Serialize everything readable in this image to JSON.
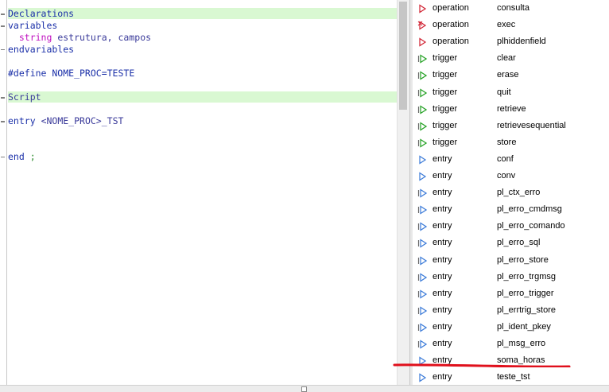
{
  "editor": {
    "lines": {
      "declarations": "Declarations",
      "variables": "variables",
      "string_kw": "string",
      "string_vars": "estrutura, campos",
      "endvariables": "endvariables",
      "define": "#define NOME_PROC=TESTE",
      "script": "Script",
      "entry_kw": "entry",
      "entry_name": "<NOME_PROC>_TST",
      "end_kw": "end",
      "end_semi": ";"
    }
  },
  "outline": {
    "items": [
      {
        "kind": "operation",
        "name": "consulta",
        "icon": "operation-icon"
      },
      {
        "kind": "operation",
        "name": "exec",
        "icon": "operation-private-icon"
      },
      {
        "kind": "operation",
        "name": "plhiddenfield",
        "icon": "operation-icon"
      },
      {
        "kind": "trigger",
        "name": "clear",
        "icon": "trigger-icon"
      },
      {
        "kind": "trigger",
        "name": "erase",
        "icon": "trigger-icon"
      },
      {
        "kind": "trigger",
        "name": "quit",
        "icon": "trigger-icon"
      },
      {
        "kind": "trigger",
        "name": "retrieve",
        "icon": "trigger-icon"
      },
      {
        "kind": "trigger",
        "name": "retrievesequential",
        "icon": "trigger-icon"
      },
      {
        "kind": "trigger",
        "name": "store",
        "icon": "trigger-icon"
      },
      {
        "kind": "entry",
        "name": "conf",
        "icon": "entry-icon"
      },
      {
        "kind": "entry",
        "name": "conv",
        "icon": "entry-icon"
      },
      {
        "kind": "entry",
        "name": "pl_ctx_erro",
        "icon": "entry-inherited-icon"
      },
      {
        "kind": "entry",
        "name": "pl_erro_cmdmsg",
        "icon": "entry-inherited-icon"
      },
      {
        "kind": "entry",
        "name": "pl_erro_comando",
        "icon": "entry-inherited-icon"
      },
      {
        "kind": "entry",
        "name": "pl_erro_sql",
        "icon": "entry-inherited-icon"
      },
      {
        "kind": "entry",
        "name": "pl_erro_store",
        "icon": "entry-inherited-icon"
      },
      {
        "kind": "entry",
        "name": "pl_erro_trgmsg",
        "icon": "entry-inherited-icon"
      },
      {
        "kind": "entry",
        "name": "pl_erro_trigger",
        "icon": "entry-inherited-icon"
      },
      {
        "kind": "entry",
        "name": "pl_errtrig_store",
        "icon": "entry-inherited-icon"
      },
      {
        "kind": "entry",
        "name": "pl_ident_pkey",
        "icon": "entry-inherited-icon"
      },
      {
        "kind": "entry",
        "name": "pl_msg_erro",
        "icon": "entry-inherited-icon"
      },
      {
        "kind": "entry",
        "name": "soma_horas",
        "icon": "entry-icon"
      },
      {
        "kind": "entry",
        "name": "teste_tst",
        "icon": "entry-icon"
      }
    ]
  },
  "colors": {
    "highlight": "#d9f8d2",
    "keyword": "#1a2fa8",
    "string_keyword": "#c010c0",
    "operation_icon": "#d02030",
    "trigger_icon": "#22a022",
    "entry_icon": "#3a7ad8",
    "annotation_line": "#e0101c"
  }
}
